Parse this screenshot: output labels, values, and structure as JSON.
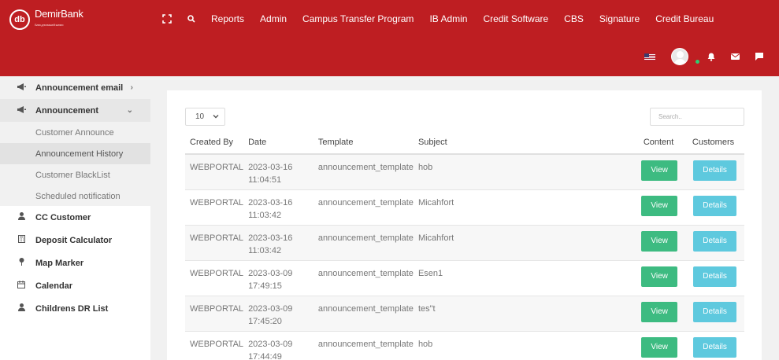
{
  "app": {
    "logo_mark": "db",
    "logo_name": "DemirBank",
    "logo_tagline": "Банк для вашей жизни"
  },
  "nav": {
    "items": [
      "Reports",
      "Admin",
      "Campus Transfer Program",
      "IB Admin",
      "Credit Software",
      "CBS",
      "Signature",
      "Credit Bureau"
    ],
    "icons": [
      "fullscreen-icon",
      "search-icon"
    ]
  },
  "header_right": {
    "icons": [
      "us-flag-icon",
      "avatar",
      "bell-icon",
      "mail-icon",
      "chat-icon"
    ]
  },
  "sidebar": {
    "items": [
      {
        "label": "Announcement email",
        "icon": "megaphone-icon",
        "chevron": "right"
      },
      {
        "label": "Announcement",
        "icon": "megaphone-icon",
        "chevron": "down"
      }
    ],
    "sub_items": [
      {
        "label": "Customer Announce"
      },
      {
        "label": "Announcement History"
      },
      {
        "label": "Customer BlackList"
      },
      {
        "label": "Scheduled notification"
      }
    ],
    "lower_items": [
      {
        "label": "CC Customer",
        "icon": "user-icon"
      },
      {
        "label": "Deposit Calculator",
        "icon": "calculator-icon"
      },
      {
        "label": "Map Marker",
        "icon": "pin-icon"
      },
      {
        "label": "Calendar",
        "icon": "calendar-icon"
      },
      {
        "label": "Childrens DR List",
        "icon": "user-icon"
      }
    ]
  },
  "table_controls": {
    "page_size": "10",
    "search_placeholder": "Search.."
  },
  "table": {
    "headers": [
      "Created By",
      "Date",
      "Template",
      "Subject",
      "Content",
      "Customers"
    ],
    "view_label": "View",
    "details_label": "Details",
    "rows": [
      {
        "created_by": "WEBPORTAL",
        "date": "2023-03-16",
        "time": "11:04:51",
        "template": "announcement_template",
        "subject": "hob"
      },
      {
        "created_by": "WEBPORTAL",
        "date": "2023-03-16",
        "time": "11:03:42",
        "template": "announcement_template",
        "subject": "Micahfort"
      },
      {
        "created_by": "WEBPORTAL",
        "date": "2023-03-16",
        "time": "11:03:42",
        "template": "announcement_template",
        "subject": "Micahfort"
      },
      {
        "created_by": "WEBPORTAL",
        "date": "2023-03-09",
        "time": "17:49:15",
        "template": "announcement_template",
        "subject": "Esen1"
      },
      {
        "created_by": "WEBPORTAL",
        "date": "2023-03-09",
        "time": "17:45:20",
        "template": "announcement_template",
        "subject": "tes\"t"
      },
      {
        "created_by": "WEBPORTAL",
        "date": "2023-03-09",
        "time": "17:44:49",
        "template": "announcement_template",
        "subject": "hob"
      }
    ]
  },
  "colors": {
    "header": "#be1e22",
    "view_button": "#3dbb81",
    "details_button": "#5ec9de",
    "online_dot": "#2ecc71"
  }
}
